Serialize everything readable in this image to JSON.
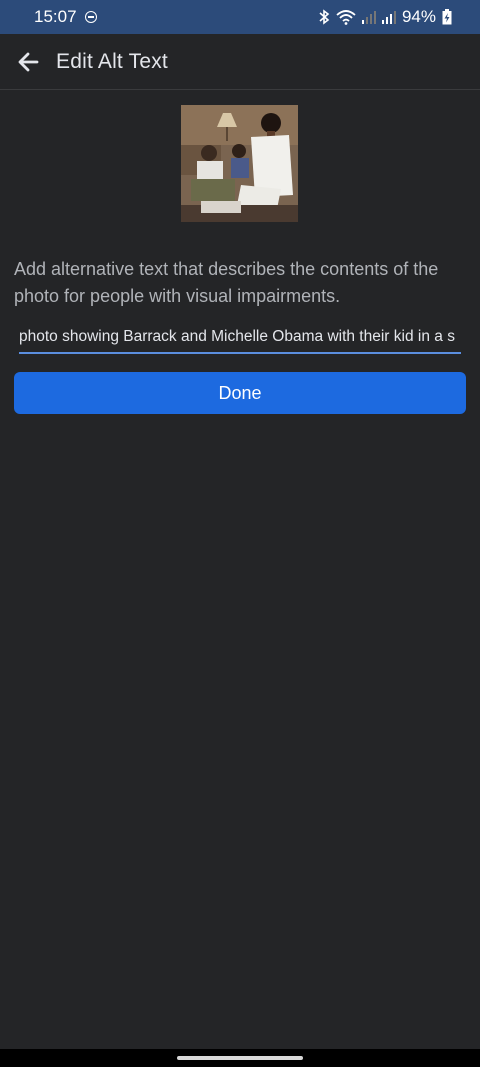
{
  "status_bar": {
    "time": "15:07",
    "battery": "94%",
    "icons": [
      "do-not-disturb-icon",
      "bluetooth-icon",
      "wifi-icon",
      "signal-icon",
      "signal-icon",
      "battery-charging-icon"
    ]
  },
  "header": {
    "title": "Edit Alt Text",
    "back_icon": "back-arrow-icon"
  },
  "main": {
    "description": "Add alternative text that describes the contents of the photo for people with visual impairments.",
    "alt_text_value": "photo showing Barrack and Michelle Obama with their kid in a s",
    "done_label": "Done"
  },
  "colors": {
    "background": "#242527",
    "status_bar": "#2c4b7a",
    "accent": "#1d6ae0",
    "input_underline": "#5b8fe0"
  }
}
